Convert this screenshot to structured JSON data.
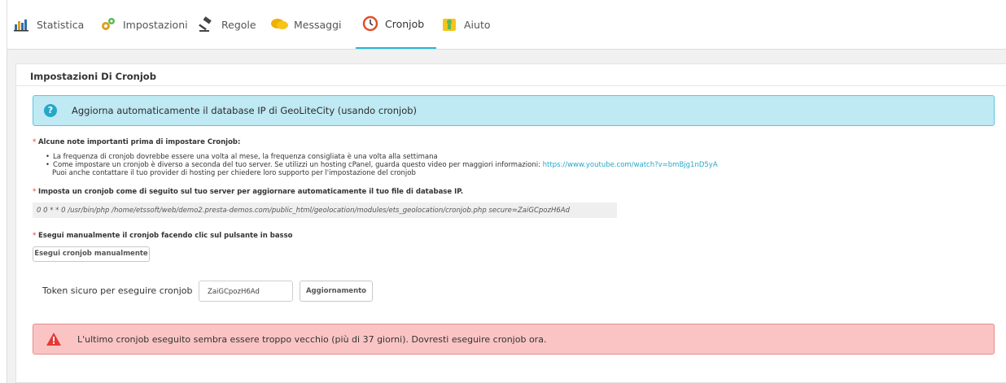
{
  "tabs": [
    {
      "label": "Statistica",
      "icon": "chart-icon"
    },
    {
      "label": "Impostazioni",
      "icon": "gears-icon"
    },
    {
      "label": "Regole",
      "icon": "gavel-icon"
    },
    {
      "label": "Messaggi",
      "icon": "chat-bubbles-icon"
    },
    {
      "label": "Cronjob",
      "icon": "clock-icon",
      "active": true
    },
    {
      "label": "Aiuto",
      "icon": "help-icon"
    }
  ],
  "panel": {
    "title": "Impostazioni Di Cronjob",
    "info": "Aggiorna automaticamente il database IP di GeoLiteCity (usando cronjob)",
    "note_title": "Alcune note importanti prima di impostare Cronjob:",
    "bullet1": "La frequenza di cronjob dovrebbe essere una volta al mese, la frequenza consigliata è una volta alla settimana",
    "bullet2": "Come impostare un cronjob è diverso a seconda del tuo server. Se utilizzi un hosting cPanel, guarda questo video per maggiori informazioni: ",
    "bullet2_link": "https://www.youtube.com/watch?v=bmBjg1nD5yA",
    "bullet3": "Puoi anche contattare il tuo provider di hosting per chiedere loro supporto per l'impostazione del cronjob",
    "setup_title": "Imposta un cronjob come di seguito sul tuo server per aggiornare automaticamente il tuo file di database IP.",
    "command": "0 0 * * 0 /usr/bin/php /home/etssoft/web/demo2.presta-demos.com/public_html/geolocation/modules/ets_geolocation/cronjob.php secure=ZaiGCpozH6Ad",
    "manual_title": "Esegui manualmente il cronjob facendo clic sul pulsante in basso",
    "manual_button": "Esegui cronjob manualmente",
    "token_label": "Token sicuro per eseguire cronjob",
    "token_value": "ZaiGCpozH6Ad",
    "update_button": "Aggiornamento",
    "alert": "L'ultimo cronjob eseguito sembra essere troppo vecchio (più di 37 giorni). Dovresti eseguire cronjob ora."
  },
  "colors": {
    "accent": "#25b9d7",
    "info_bg": "#bfe9f3",
    "alert_bg": "#fbc4c4",
    "alert_icon": "#e53935"
  }
}
